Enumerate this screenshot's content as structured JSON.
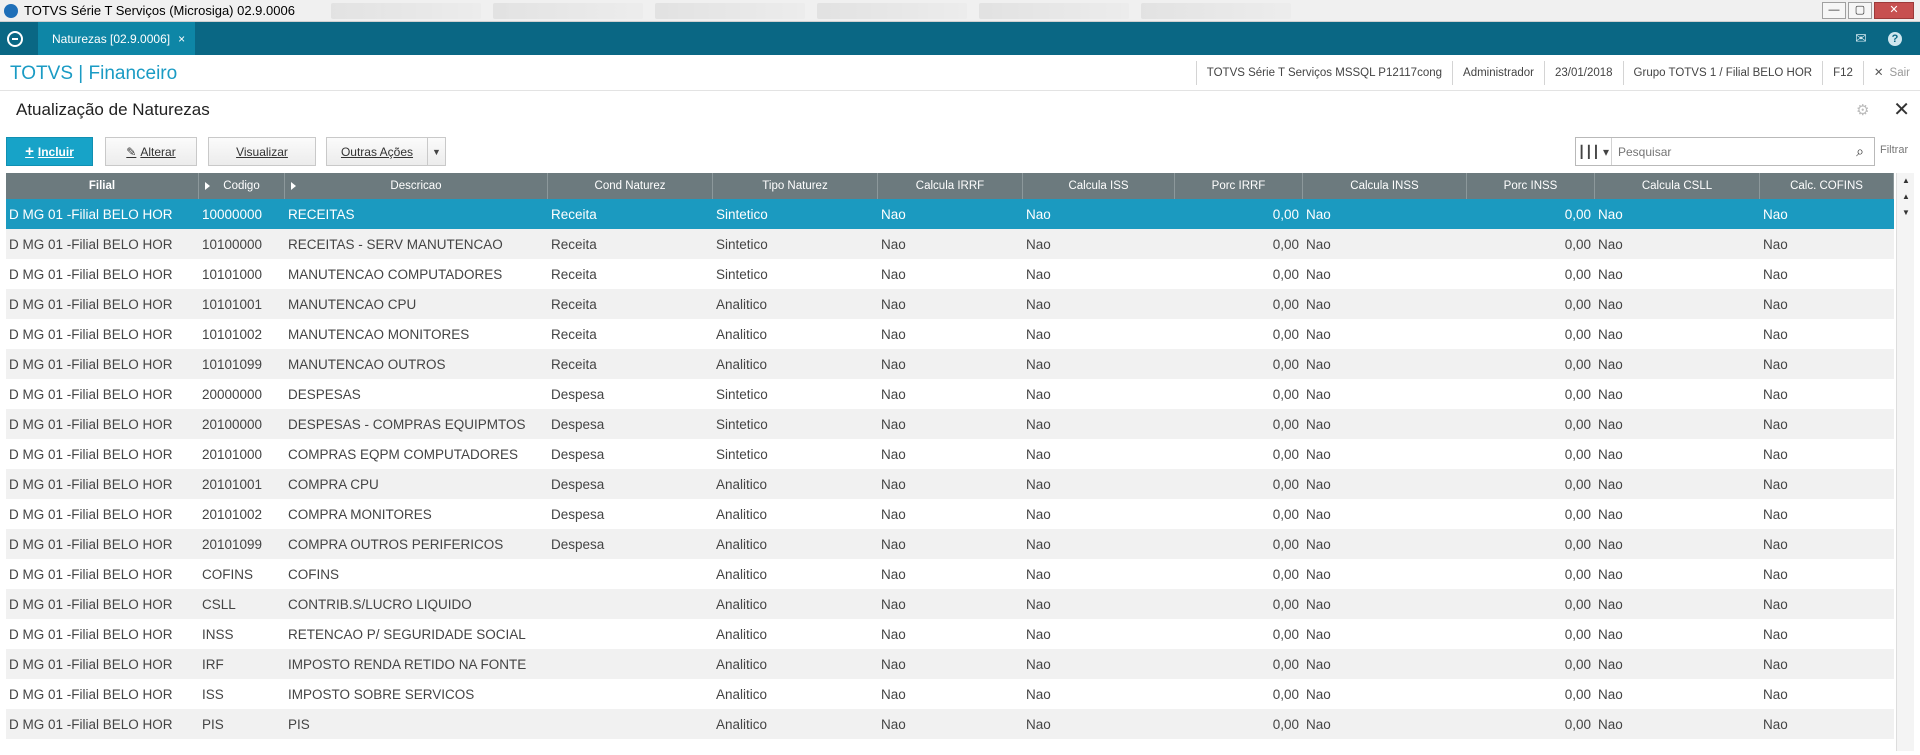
{
  "window": {
    "title": "TOTVS Série T Serviços (Microsiga) 02.9.0006",
    "min_label": "—",
    "max_label": "▢",
    "close_label": "✕"
  },
  "tabbar": {
    "tab_label": "Naturezas [02.9.0006]",
    "tab_close": "×",
    "mail_glyph": "✉",
    "help_glyph": "?"
  },
  "header": {
    "brand": "TOTVS | Financeiro",
    "environment": "TOTVS Série T Serviços MSSQL P12117cong",
    "user": "Administrador",
    "date": "23/01/2018",
    "group": "Grupo TOTVS 1 / Filial BELO HOR",
    "shortcut": "F12",
    "sair_x": "✕",
    "sair": "Sair"
  },
  "page": {
    "title": "Atualização de Naturezas",
    "close_glyph": "✕",
    "gear_glyph": "⚙"
  },
  "toolbar": {
    "incluir": "Incluir",
    "alterar": "Alterar",
    "visualizar": "Visualizar",
    "outras_acoes": "Outras Ações",
    "search_placeholder": "Pesquisar",
    "filtrar": "Filtrar"
  },
  "grid": {
    "columns": [
      "Filial",
      "Codigo",
      "Descricao",
      "Cond Naturez",
      "Tipo Naturez",
      "Calcula IRRF",
      "Calcula ISS",
      "Porc IRRF",
      "Calcula INSS",
      "Porc INSS",
      "Calcula CSLL",
      "Calc. COFINS"
    ],
    "rows": [
      [
        "D MG 01 -Filial BELO HOR",
        "10000000",
        "RECEITAS",
        "Receita",
        "Sintetico",
        "Nao",
        "Nao",
        "0,00",
        "Nao",
        "0,00",
        "Nao",
        "Nao"
      ],
      [
        "D MG 01 -Filial BELO HOR",
        "10100000",
        "RECEITAS - SERV MANUTENCAO",
        "Receita",
        "Sintetico",
        "Nao",
        "Nao",
        "0,00",
        "Nao",
        "0,00",
        "Nao",
        "Nao"
      ],
      [
        "D MG 01 -Filial BELO HOR",
        "10101000",
        "MANUTENCAO COMPUTADORES",
        "Receita",
        "Sintetico",
        "Nao",
        "Nao",
        "0,00",
        "Nao",
        "0,00",
        "Nao",
        "Nao"
      ],
      [
        "D MG 01 -Filial BELO HOR",
        "10101001",
        "MANUTENCAO CPU",
        "Receita",
        "Analitico",
        "Nao",
        "Nao",
        "0,00",
        "Nao",
        "0,00",
        "Nao",
        "Nao"
      ],
      [
        "D MG 01 -Filial BELO HOR",
        "10101002",
        "MANUTENCAO MONITORES",
        "Receita",
        "Analitico",
        "Nao",
        "Nao",
        "0,00",
        "Nao",
        "0,00",
        "Nao",
        "Nao"
      ],
      [
        "D MG 01 -Filial BELO HOR",
        "10101099",
        "MANUTENCAO OUTROS",
        "Receita",
        "Analitico",
        "Nao",
        "Nao",
        "0,00",
        "Nao",
        "0,00",
        "Nao",
        "Nao"
      ],
      [
        "D MG 01 -Filial BELO HOR",
        "20000000",
        "DESPESAS",
        "Despesa",
        "Sintetico",
        "Nao",
        "Nao",
        "0,00",
        "Nao",
        "0,00",
        "Nao",
        "Nao"
      ],
      [
        "D MG 01 -Filial BELO HOR",
        "20100000",
        "DESPESAS - COMPRAS EQUIPMTOS",
        "Despesa",
        "Sintetico",
        "Nao",
        "Nao",
        "0,00",
        "Nao",
        "0,00",
        "Nao",
        "Nao"
      ],
      [
        "D MG 01 -Filial BELO HOR",
        "20101000",
        "COMPRAS EQPM COMPUTADORES",
        "Despesa",
        "Sintetico",
        "Nao",
        "Nao",
        "0,00",
        "Nao",
        "0,00",
        "Nao",
        "Nao"
      ],
      [
        "D MG 01 -Filial BELO HOR",
        "20101001",
        "COMPRA CPU",
        "Despesa",
        "Analitico",
        "Nao",
        "Nao",
        "0,00",
        "Nao",
        "0,00",
        "Nao",
        "Nao"
      ],
      [
        "D MG 01 -Filial BELO HOR",
        "20101002",
        "COMPRA MONITORES",
        "Despesa",
        "Analitico",
        "Nao",
        "Nao",
        "0,00",
        "Nao",
        "0,00",
        "Nao",
        "Nao"
      ],
      [
        "D MG 01 -Filial BELO HOR",
        "20101099",
        "COMPRA OUTROS PERIFERICOS",
        "Despesa",
        "Analitico",
        "Nao",
        "Nao",
        "0,00",
        "Nao",
        "0,00",
        "Nao",
        "Nao"
      ],
      [
        "D MG 01 -Filial BELO HOR",
        "COFINS",
        "COFINS",
        "",
        "Analitico",
        "Nao",
        "Nao",
        "0,00",
        "Nao",
        "0,00",
        "Nao",
        "Nao"
      ],
      [
        "D MG 01 -Filial BELO HOR",
        "CSLL",
        "CONTRIB.S/LUCRO LIQUIDO",
        "",
        "Analitico",
        "Nao",
        "Nao",
        "0,00",
        "Nao",
        "0,00",
        "Nao",
        "Nao"
      ],
      [
        "D MG 01 -Filial BELO HOR",
        "INSS",
        "RETENCAO P/ SEGURIDADE SOCIAL",
        "",
        "Analitico",
        "Nao",
        "Nao",
        "0,00",
        "Nao",
        "0,00",
        "Nao",
        "Nao"
      ],
      [
        "D MG 01 -Filial BELO HOR",
        "IRF",
        "IMPOSTO RENDA RETIDO NA FONTE",
        "",
        "Analitico",
        "Nao",
        "Nao",
        "0,00",
        "Nao",
        "0,00",
        "Nao",
        "Nao"
      ],
      [
        "D MG 01 -Filial BELO HOR",
        "ISS",
        "IMPOSTO SOBRE SERVICOS",
        "",
        "Analitico",
        "Nao",
        "Nao",
        "0,00",
        "Nao",
        "0,00",
        "Nao",
        "Nao"
      ],
      [
        "D MG 01 -Filial BELO HOR",
        "PIS",
        "PIS",
        "",
        "Analitico",
        "Nao",
        "Nao",
        "0,00",
        "Nao",
        "0,00",
        "Nao",
        "Nao"
      ]
    ]
  },
  "colors": {
    "tabbar": "#0a6784",
    "accent": "#1a9bc4",
    "selected_row": "#1b9ac0",
    "grid_header": "#6c7a7e"
  }
}
